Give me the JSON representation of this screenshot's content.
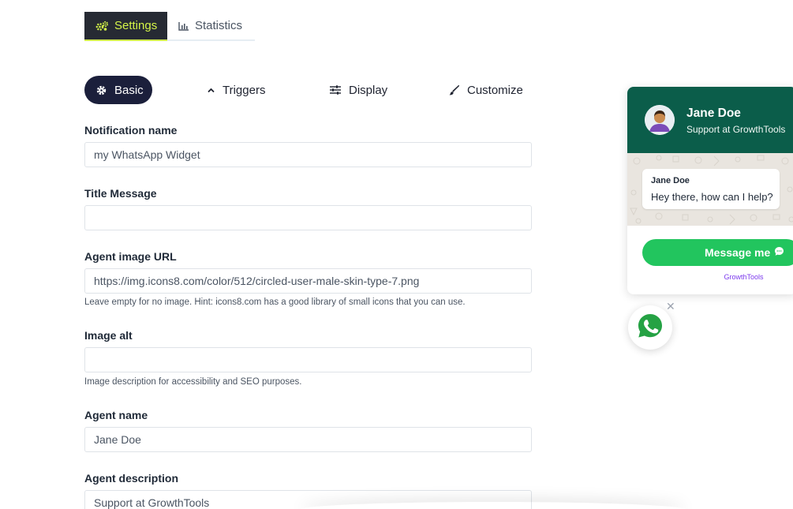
{
  "top_tabs": [
    {
      "label": "Settings",
      "icon": "gears-icon",
      "active": true
    },
    {
      "label": "Statistics",
      "icon": "bar-chart-icon",
      "active": false
    }
  ],
  "sub_tabs": [
    {
      "label": "Basic",
      "icon": "gear-icon",
      "active": true
    },
    {
      "label": "Triggers",
      "icon": "chevron-up-icon",
      "active": false
    },
    {
      "label": "Display",
      "icon": "sliders-icon",
      "active": false
    },
    {
      "label": "Customize",
      "icon": "paintbrush-icon",
      "active": false
    }
  ],
  "form": {
    "notification_name": {
      "label": "Notification name",
      "value": "my WhatsApp Widget"
    },
    "title_message": {
      "label": "Title Message",
      "value": ""
    },
    "agent_image_url": {
      "label": "Agent image URL",
      "value": "https://img.icons8.com/color/512/circled-user-male-skin-type-7.png",
      "hint": "Leave empty for no image. Hint: icons8.com has a good library of small icons that you can use."
    },
    "image_alt": {
      "label": "Image alt",
      "value": "",
      "hint": "Image description for accessibility and SEO purposes."
    },
    "agent_name": {
      "label": "Agent name",
      "value": "Jane Doe"
    },
    "agent_description": {
      "label": "Agent description",
      "value": "Support at GrowthTools"
    }
  },
  "widget": {
    "agent_name": "Jane Doe",
    "agent_description": "Support at GrowthTools",
    "bubble_name": "Jane Doe",
    "bubble_text": "Hey there, how can I help?",
    "button_label": "Message me",
    "powered_by": "GrowthTools",
    "close_symbol": "✕",
    "colors": {
      "header": "#0b5d4a",
      "button": "#22c55e",
      "brand_link": "#7c3aed",
      "whatsapp": "#25a244"
    }
  },
  "colors": {
    "active_top_tab_bg": "#262a33",
    "active_top_tab_text": "#d4f448",
    "active_sub_tab_bg": "#1b1f3b"
  }
}
